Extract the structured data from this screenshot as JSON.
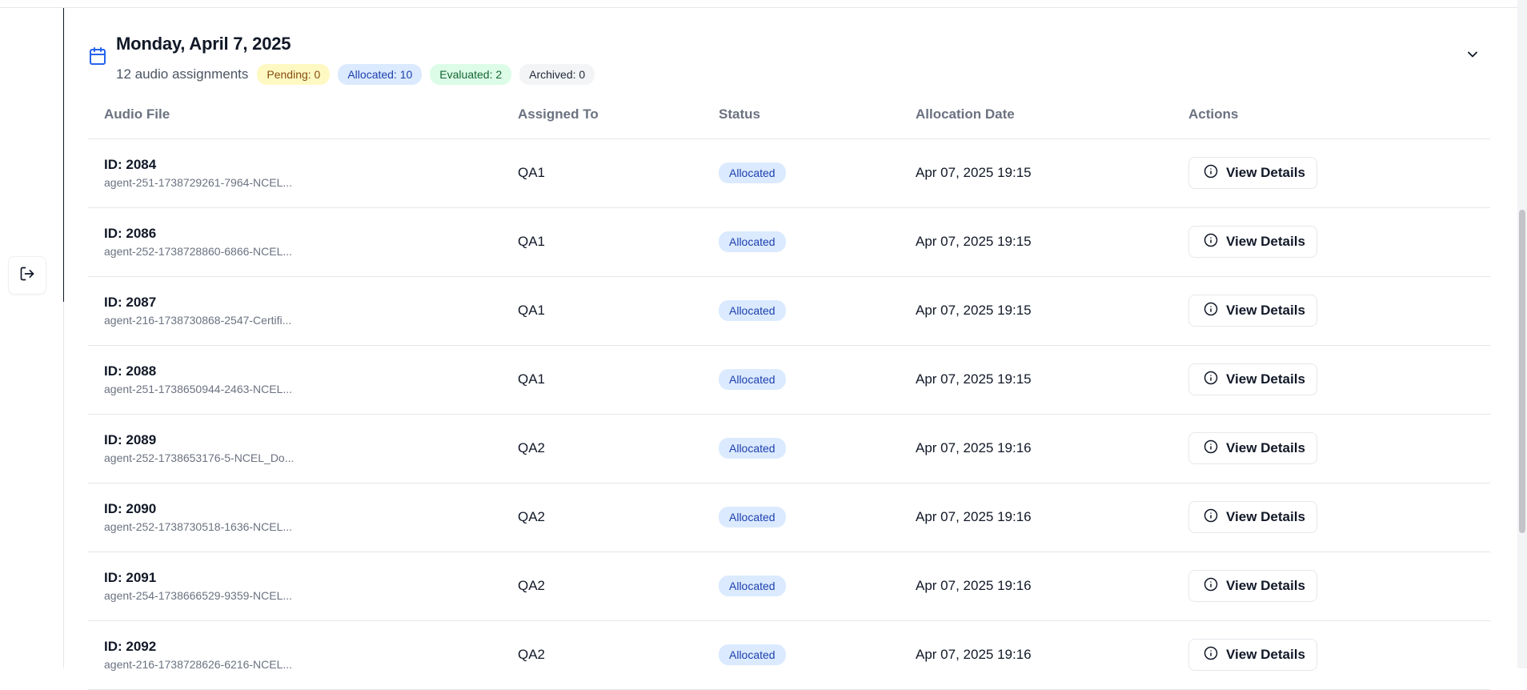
{
  "group": {
    "title": "Monday, April 7, 2025",
    "count_text": "12 audio assignments",
    "chips": {
      "pending": "Pending: 0",
      "allocated": "Allocated: 10",
      "evaluated": "Evaluated: 2",
      "archived": "Archived: 0"
    }
  },
  "table": {
    "headers": {
      "audio_file": "Audio File",
      "assigned_to": "Assigned To",
      "status": "Status",
      "allocation_date": "Allocation Date",
      "actions": "Actions"
    },
    "rows": [
      {
        "id": "ID: 2084",
        "file": "agent-251-1738729261-7964-NCEL...",
        "assigned": "QA1",
        "status": "Allocated",
        "date": "Apr 07, 2025 19:15",
        "action": "View Details"
      },
      {
        "id": "ID: 2086",
        "file": "agent-252-1738728860-6866-NCEL...",
        "assigned": "QA1",
        "status": "Allocated",
        "date": "Apr 07, 2025 19:15",
        "action": "View Details"
      },
      {
        "id": "ID: 2087",
        "file": "agent-216-1738730868-2547-Certifi...",
        "assigned": "QA1",
        "status": "Allocated",
        "date": "Apr 07, 2025 19:15",
        "action": "View Details"
      },
      {
        "id": "ID: 2088",
        "file": "agent-251-1738650944-2463-NCEL...",
        "assigned": "QA1",
        "status": "Allocated",
        "date": "Apr 07, 2025 19:15",
        "action": "View Details"
      },
      {
        "id": "ID: 2089",
        "file": "agent-252-1738653176-5-NCEL_Do...",
        "assigned": "QA2",
        "status": "Allocated",
        "date": "Apr 07, 2025 19:16",
        "action": "View Details"
      },
      {
        "id": "ID: 2090",
        "file": "agent-252-1738730518-1636-NCEL...",
        "assigned": "QA2",
        "status": "Allocated",
        "date": "Apr 07, 2025 19:16",
        "action": "View Details"
      },
      {
        "id": "ID: 2091",
        "file": "agent-254-1738666529-9359-NCEL...",
        "assigned": "QA2",
        "status": "Allocated",
        "date": "Apr 07, 2025 19:16",
        "action": "View Details"
      },
      {
        "id": "ID: 2092",
        "file": "agent-216-1738728626-6216-NCEL...",
        "assigned": "QA2",
        "status": "Allocated",
        "date": "Apr 07, 2025 19:16",
        "action": "View Details"
      }
    ]
  },
  "icons": {
    "calendar": "calendar-icon",
    "logout": "logout-icon",
    "chevron": "chevron-down-icon",
    "info": "info-icon"
  },
  "colors": {
    "accent": "#2563eb",
    "pending_bg": "#fef9c3",
    "allocated_bg": "#dbeafe",
    "evaluated_bg": "#dcfce7",
    "archived_bg": "#f3f4f6"
  }
}
